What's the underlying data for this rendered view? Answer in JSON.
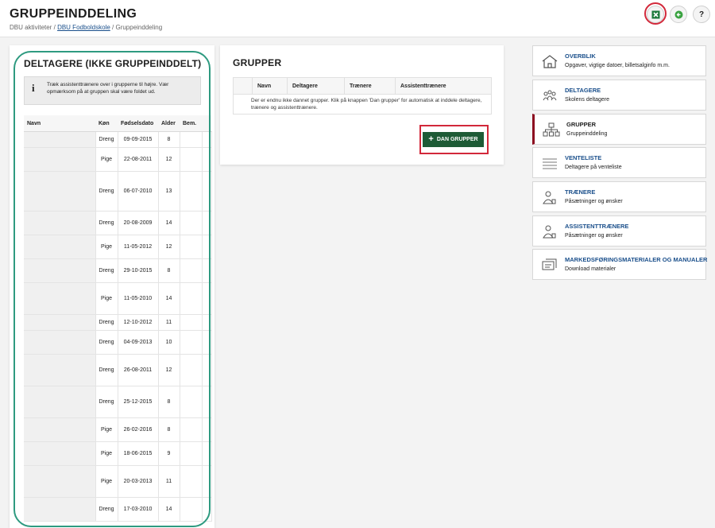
{
  "header": {
    "title": "GRUPPEINDDELING",
    "breadcrumb": {
      "root": "DBU aktiviteter",
      "link": "DBU Fodboldskole",
      "current": "Gruppeinddeling",
      "sep": "/"
    },
    "help_label": "?"
  },
  "participants": {
    "title": "DELTAGERE (IKKE GRUPPEINDDELT)",
    "info": "Træk assistenttrænere over i grupperne til højre. Vær opmærksom på at gruppen skal være foldet ud.",
    "info_icon": "i",
    "columns": [
      "Navn",
      "Køn",
      "Fødselsdato",
      "Alder",
      "Bem."
    ],
    "rows": [
      {
        "gender": "Dreng",
        "dob": "09-09-2015",
        "age": "8"
      },
      {
        "gender": "Pige",
        "dob": "22-08-2011",
        "age": "12"
      },
      {
        "gender": "Dreng",
        "dob": "06-07-2010",
        "age": "13"
      },
      {
        "gender": "Dreng",
        "dob": "20-08-2009",
        "age": "14"
      },
      {
        "gender": "Pige",
        "dob": "11-05-2012",
        "age": "12"
      },
      {
        "gender": "Dreng",
        "dob": "29-10-2015",
        "age": "8"
      },
      {
        "gender": "Pige",
        "dob": "11-05-2010",
        "age": "14"
      },
      {
        "gender": "Dreng",
        "dob": "12-10-2012",
        "age": "11"
      },
      {
        "gender": "Dreng",
        "dob": "04-09-2013",
        "age": "10"
      },
      {
        "gender": "Dreng",
        "dob": "26-08-2011",
        "age": "12"
      },
      {
        "gender": "Dreng",
        "dob": "25-12-2015",
        "age": "8"
      },
      {
        "gender": "Pige",
        "dob": "26-02-2016",
        "age": "8"
      },
      {
        "gender": "Pige",
        "dob": "18-06-2015",
        "age": "9"
      },
      {
        "gender": "Pige",
        "dob": "20-03-2013",
        "age": "11"
      },
      {
        "gender": "Dreng",
        "dob": "17-03-2010",
        "age": "14"
      }
    ]
  },
  "groups": {
    "title": "GRUPPER",
    "columns": [
      "Navn",
      "Deltagere",
      "Trænere",
      "Assistenttrænere"
    ],
    "empty_text": "Der er endnu ikke dannet grupper. Klik på knappen 'Dan grupper' for automatisk at inddele deltagere, trænere og assistenttrænere.",
    "create_button": "DAN GRUPPER"
  },
  "nav": [
    {
      "title": "OVERBLIK",
      "sub": "Opgaver, vigtige datoer, billetsalginfo m.m.",
      "icon": "house-icon"
    },
    {
      "title": "DELTAGERE",
      "sub": "Skolens deltagere",
      "icon": "people-icon"
    },
    {
      "title": "GRUPPER",
      "sub": "Gruppeinddeling",
      "icon": "hierarchy-icon"
    },
    {
      "title": "VENTELISTE",
      "sub": "Deltagere på venteliste",
      "icon": "list-icon"
    },
    {
      "title": "TRÆNERE",
      "sub": "Påsætninger og ønsker",
      "icon": "coach-icon"
    },
    {
      "title": "ASSISTENTTRÆNERE",
      "sub": "Påsætninger og ønsker",
      "icon": "assistant-coach-icon"
    },
    {
      "title": "MARKEDSFØRINGSMATERIALER OG MANUALER",
      "sub": "Download materialer",
      "icon": "materials-icon"
    }
  ],
  "colors": {
    "accent_green": "#1e5b36",
    "highlight_red": "#d2283a",
    "active_marker": "#8c0a1f",
    "link_blue": "#1a4f8b",
    "ring_teal": "#2e9a80"
  }
}
